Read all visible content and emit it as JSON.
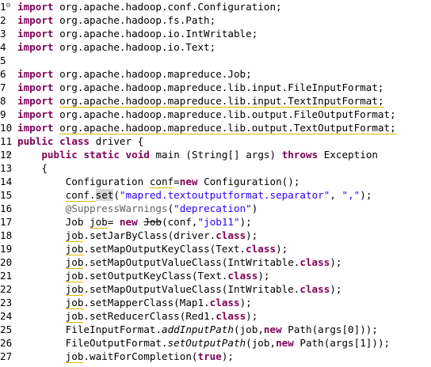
{
  "editor": {
    "lines": [
      {
        "num": "1",
        "fold": "minus",
        "tokens": [
          {
            "t": "import",
            "c": "kw"
          },
          {
            "t": " org.apache.hadoop.conf.Configuration;"
          }
        ]
      },
      {
        "num": "2",
        "tokens": [
          {
            "t": "import",
            "c": "kw"
          },
          {
            "t": " org.apache.hadoop.fs.Path;"
          }
        ]
      },
      {
        "num": "3",
        "tokens": [
          {
            "t": "import",
            "c": "kw"
          },
          {
            "t": " org.apache.hadoop.io.IntWritable;"
          }
        ]
      },
      {
        "num": "4",
        "tokens": [
          {
            "t": "import",
            "c": "kw"
          },
          {
            "t": " org.apache.hadoop.io.Text;"
          }
        ]
      },
      {
        "num": "5",
        "tokens": []
      },
      {
        "num": "6",
        "tokens": [
          {
            "t": "import",
            "c": "kw"
          },
          {
            "t": " org.apache.hadoop.mapreduce.Job;"
          }
        ]
      },
      {
        "num": "7",
        "tokens": [
          {
            "t": "import",
            "c": "kw"
          },
          {
            "t": " org.apache.hadoop.mapreduce.lib.input.FileInputFormat;"
          }
        ]
      },
      {
        "num": "8",
        "tokens": [
          {
            "t": "import",
            "c": "kw"
          },
          {
            "t": " "
          },
          {
            "t": "org.apache.hadoop.mapreduce.lib.input.TextInputFormat;",
            "c": "warn"
          }
        ]
      },
      {
        "num": "9",
        "tokens": [
          {
            "t": "import",
            "c": "kw"
          },
          {
            "t": " org.apache.hadoop.mapreduce.lib.output.FileOutputFormat;"
          }
        ]
      },
      {
        "num": "10",
        "tokens": [
          {
            "t": "import",
            "c": "kw"
          },
          {
            "t": " "
          },
          {
            "t": "org.apache.hadoop.mapreduce.lib.output.TextOutputFormat;",
            "c": "warn"
          }
        ]
      },
      {
        "num": "11",
        "tokens": [
          {
            "t": "public",
            "c": "kw"
          },
          {
            "t": " "
          },
          {
            "t": "class",
            "c": "kw"
          },
          {
            "t": " driver {"
          }
        ]
      },
      {
        "num": "12",
        "fold": "minus",
        "tokens": [
          {
            "t": "    "
          },
          {
            "t": "public",
            "c": "kw"
          },
          {
            "t": " "
          },
          {
            "t": "static",
            "c": "kw"
          },
          {
            "t": " "
          },
          {
            "t": "void",
            "c": "kw"
          },
          {
            "t": " main (String[] args) "
          },
          {
            "t": "throws",
            "c": "kw"
          },
          {
            "t": " Exception"
          }
        ]
      },
      {
        "num": "13",
        "tokens": [
          {
            "t": "    {"
          }
        ]
      },
      {
        "num": "14",
        "tokens": [
          {
            "t": "        Configuration "
          },
          {
            "t": "conf",
            "c": "warn"
          },
          {
            "t": "="
          },
          {
            "t": "new",
            "c": "kw"
          },
          {
            "t": " Configuration();"
          }
        ]
      },
      {
        "num": "15",
        "tokens": [
          {
            "t": "        "
          },
          {
            "t": "conf.",
            "c": "warn"
          },
          {
            "t": "set",
            "c": "hl"
          },
          {
            "t": "("
          },
          {
            "t": "\"mapred.textoutputformat.separator\"",
            "c": "str"
          },
          {
            "t": ", "
          },
          {
            "t": "\",\"",
            "c": "str"
          },
          {
            "t": ");"
          }
        ]
      },
      {
        "num": "16",
        "tokens": [
          {
            "t": "        "
          },
          {
            "t": "@SuppressWarnings",
            "c": "ann"
          },
          {
            "t": "("
          },
          {
            "t": "\"deprecation\"",
            "c": "str"
          },
          {
            "t": ")"
          }
        ]
      },
      {
        "num": "17",
        "tokens": [
          {
            "t": "        Job "
          },
          {
            "t": "job",
            "c": "warn"
          },
          {
            "t": "= "
          },
          {
            "t": "new",
            "c": "kw"
          },
          {
            "t": " "
          },
          {
            "t": "Job",
            "c": "strike"
          },
          {
            "t": "(conf,"
          },
          {
            "t": "\"job11\"",
            "c": "str"
          },
          {
            "t": ");"
          }
        ]
      },
      {
        "num": "18",
        "tokens": [
          {
            "t": "        "
          },
          {
            "t": "job",
            "c": "warn"
          },
          {
            "t": ".setJarByClass(driver."
          },
          {
            "t": "class",
            "c": "kw"
          },
          {
            "t": ");"
          }
        ]
      },
      {
        "num": "19",
        "tokens": [
          {
            "t": "        "
          },
          {
            "t": "job",
            "c": "warn"
          },
          {
            "t": ".setMapOutputKeyClass(Text."
          },
          {
            "t": "class",
            "c": "kw"
          },
          {
            "t": ");"
          }
        ]
      },
      {
        "num": "20",
        "tokens": [
          {
            "t": "        "
          },
          {
            "t": "job",
            "c": "warn"
          },
          {
            "t": ".setMapOutputValueClass(IntWritable."
          },
          {
            "t": "class",
            "c": "kw"
          },
          {
            "t": ");"
          }
        ]
      },
      {
        "num": "21",
        "tokens": [
          {
            "t": "        "
          },
          {
            "t": "job",
            "c": "warn"
          },
          {
            "t": ".setOutputKeyClass(Text."
          },
          {
            "t": "class",
            "c": "kw"
          },
          {
            "t": ");"
          }
        ]
      },
      {
        "num": "22",
        "tokens": [
          {
            "t": "        "
          },
          {
            "t": "job",
            "c": "warn"
          },
          {
            "t": ".setMapOutputValueClass(IntWritable."
          },
          {
            "t": "class",
            "c": "kw"
          },
          {
            "t": ");"
          }
        ]
      },
      {
        "num": "23",
        "tokens": [
          {
            "t": "        "
          },
          {
            "t": "job",
            "c": "warn"
          },
          {
            "t": ".setMapperClass(Map1."
          },
          {
            "t": "class",
            "c": "kw"
          },
          {
            "t": ");"
          }
        ]
      },
      {
        "num": "24",
        "tokens": [
          {
            "t": "        "
          },
          {
            "t": "job",
            "c": "warn"
          },
          {
            "t": ".setReducerClass(Red1."
          },
          {
            "t": "class",
            "c": "kw"
          },
          {
            "t": ");"
          }
        ]
      },
      {
        "num": "25",
        "tokens": [
          {
            "t": "        FileInputFormat."
          },
          {
            "t": "addInputPath",
            "c": "static"
          },
          {
            "t": "(job,"
          },
          {
            "t": "new",
            "c": "kw"
          },
          {
            "t": " Path(args[0]));"
          }
        ]
      },
      {
        "num": "26",
        "tokens": [
          {
            "t": "        FileOutputFormat."
          },
          {
            "t": "setOutputPath",
            "c": "static"
          },
          {
            "t": "(job,"
          },
          {
            "t": "new",
            "c": "kw"
          },
          {
            "t": " Path(args[1]));"
          }
        ]
      },
      {
        "num": "27",
        "tokens": [
          {
            "t": "        "
          },
          {
            "t": "job",
            "c": "warn"
          },
          {
            "t": ".waitForCompletion("
          },
          {
            "t": "true",
            "c": "kw"
          },
          {
            "t": ");"
          }
        ]
      }
    ]
  }
}
